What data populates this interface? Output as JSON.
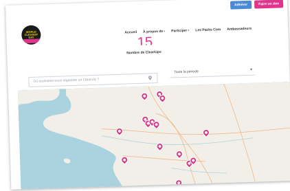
{
  "topbar": {
    "members_button": "Adhérer",
    "donate_button": "Faire un don"
  },
  "logo": {
    "text": "WORLD CLEANUP DAY"
  },
  "nav": {
    "items": [
      {
        "label": "Accueil",
        "has_dropdown": false
      },
      {
        "label": "À propos de",
        "has_dropdown": true
      },
      {
        "label": "Participer",
        "has_dropdown": true
      },
      {
        "label": "Les Packs Com",
        "has_dropdown": false
      },
      {
        "label": "Ambassadeurs",
        "has_dropdown": false
      }
    ]
  },
  "stats": {
    "number": "15",
    "label": "Nombre de CleanUps"
  },
  "search": {
    "placeholder": "Où souhaitez-vous organiser un CleanUp ?"
  },
  "filter": {
    "selected": "Toute la période"
  },
  "map": {
    "water_color": "#aad3df",
    "land_color": "#f2efe9",
    "pin_color": "#cf3d86"
  },
  "colors": {
    "accent_pink": "#e0358c",
    "accent_blue": "#4a89d6"
  }
}
